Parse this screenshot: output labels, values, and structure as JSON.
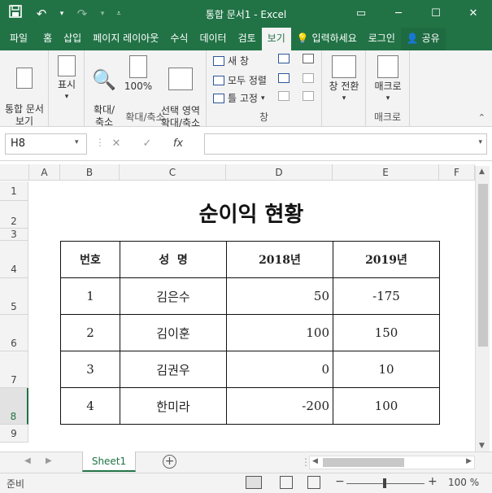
{
  "titlebar": {
    "title": "통합 문서1 - Excel",
    "save_icon": "save-icon",
    "undo_icon": "undo-icon",
    "redo_icon": "redo-icon"
  },
  "tabs": [
    "파일",
    "홈",
    "삽입",
    "페이지 레이아웃",
    "수식",
    "데이터",
    "검토",
    "보기"
  ],
  "tell_me": "입력하세요",
  "login": "로그인",
  "share": "공유",
  "ribbon": {
    "view_btn": "통합 문서\n보기",
    "show_btn": "표시",
    "zoom_btn": "확대/\n축소",
    "zoom100_btn": "100%",
    "zoom_sel_btn": "선택 영역\n확대/축소",
    "zoom_group": "확대/축소",
    "new_window": "새 창",
    "arrange_all": "모두 정렬",
    "freeze": "틀 고정",
    "window_group": "창",
    "switch_window": "창 전환",
    "macro_btn": "매크로",
    "macro_group": "매크로"
  },
  "formula": {
    "namebox": "H8",
    "fx": "fx",
    "value": ""
  },
  "columns": [
    "A",
    "B",
    "C",
    "D",
    "E",
    "F"
  ],
  "rows": [
    "1",
    "2",
    "3",
    "4",
    "5",
    "6",
    "7",
    "8",
    "9"
  ],
  "sheet": {
    "heading": "순이익 현황",
    "headers": [
      "번호",
      "성  명",
      "2018년",
      "2019년"
    ],
    "data": [
      [
        "1",
        "김은수",
        "50",
        "-175"
      ],
      [
        "2",
        "김이훈",
        "100",
        "150"
      ],
      [
        "3",
        "김권우",
        "0",
        "10"
      ],
      [
        "4",
        "한미라",
        "-200",
        "100"
      ]
    ]
  },
  "sheettab": "Sheet1",
  "status": {
    "ready": "준비",
    "zoom": "100 %"
  },
  "colors": {
    "accent": "#217346"
  }
}
